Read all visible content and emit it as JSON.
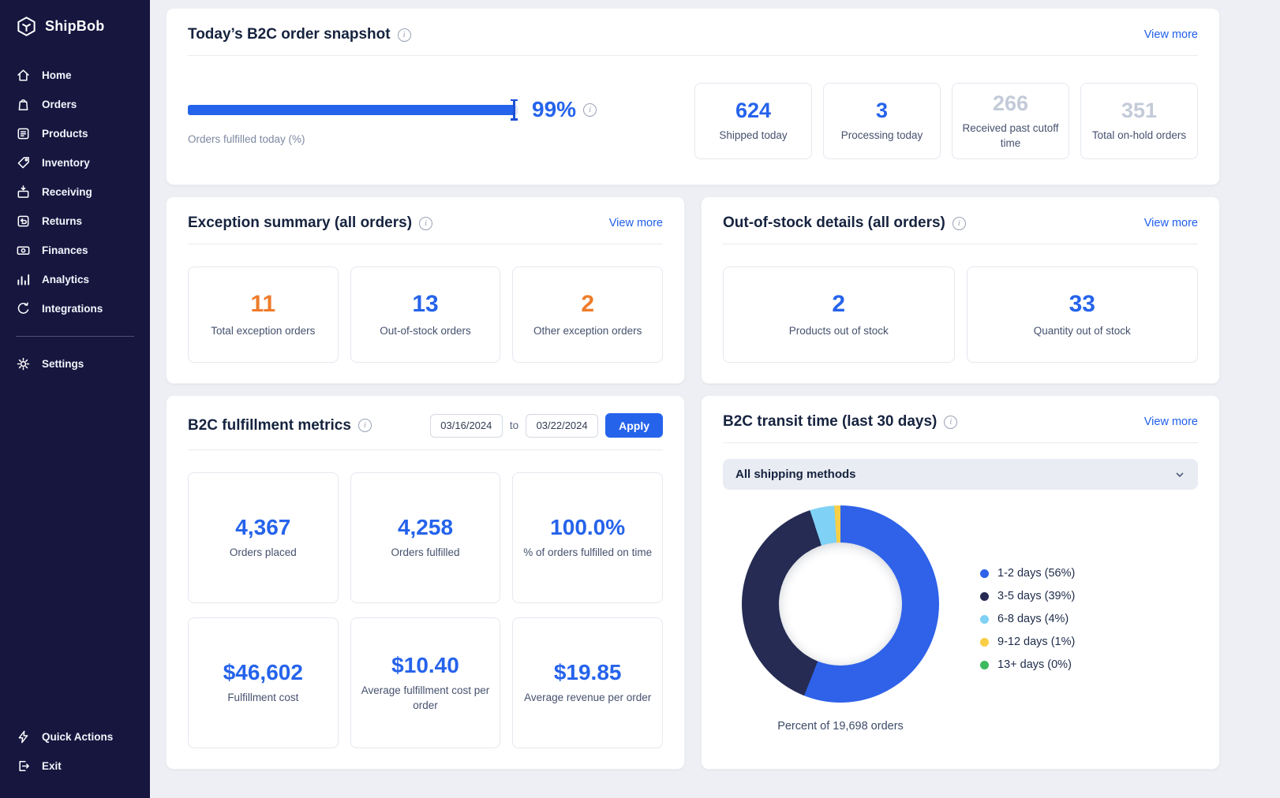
{
  "colors": {
    "accent_blue": "#2563eb",
    "orange": "#ee7c2b",
    "muted_gray": "#c3cad8",
    "sidebar_bg": "#16163f",
    "link_blue": "#1f5eea"
  },
  "sidebar": {
    "brand": "ShipBob",
    "items": [
      {
        "label": "Home",
        "icon": "home-icon"
      },
      {
        "label": "Orders",
        "icon": "orders-icon"
      },
      {
        "label": "Products",
        "icon": "products-icon"
      },
      {
        "label": "Inventory",
        "icon": "inventory-icon"
      },
      {
        "label": "Receiving",
        "icon": "receiving-icon"
      },
      {
        "label": "Returns",
        "icon": "returns-icon"
      },
      {
        "label": "Finances",
        "icon": "finances-icon"
      },
      {
        "label": "Analytics",
        "icon": "analytics-icon"
      },
      {
        "label": "Integrations",
        "icon": "integrations-icon"
      }
    ],
    "settings_label": "Settings",
    "footer_items": [
      {
        "label": "Quick Actions",
        "icon": "lightning-icon"
      },
      {
        "label": "Exit",
        "icon": "exit-icon"
      }
    ]
  },
  "snapshot": {
    "title": "Today’s B2C order snapshot",
    "view_more": "View more",
    "progress_value": 99,
    "progress_pct": "99%",
    "progress_label": "Orders fulfilled today (%)",
    "stats": [
      {
        "value": "624",
        "label": "Shipped today",
        "color": "blue"
      },
      {
        "value": "3",
        "label": "Processing today",
        "color": "blue"
      },
      {
        "value": "266",
        "label": "Received past cutoff time",
        "color": "gray"
      },
      {
        "value": "351",
        "label": "Total on-hold orders",
        "color": "gray"
      }
    ]
  },
  "exceptions": {
    "title": "Exception summary (all orders)",
    "view_more": "View more",
    "stats": [
      {
        "value": "11",
        "label": "Total exception orders",
        "color": "orange"
      },
      {
        "value": "13",
        "label": "Out-of-stock orders",
        "color": "blue"
      },
      {
        "value": "2",
        "label": "Other exception orders",
        "color": "orange"
      }
    ]
  },
  "out_of_stock": {
    "title": "Out-of-stock details (all orders)",
    "view_more": "View more",
    "stats": [
      {
        "value": "2",
        "label": "Products out of stock",
        "color": "blue"
      },
      {
        "value": "33",
        "label": "Quantity out of stock",
        "color": "blue"
      }
    ]
  },
  "fulfillment": {
    "title": "B2C fulfillment metrics",
    "date_from": "03/16/2024",
    "to_label": "to",
    "date_to": "03/22/2024",
    "apply_label": "Apply",
    "stats": [
      {
        "value": "4,367",
        "label": "Orders placed",
        "color": "blue"
      },
      {
        "value": "4,258",
        "label": "Orders fulfilled",
        "color": "blue"
      },
      {
        "value": "100.0%",
        "label": "% of orders fulfilled on time",
        "color": "blue"
      },
      {
        "value": "$46,602",
        "label": "Fulfillment cost",
        "color": "blue"
      },
      {
        "value": "$10.40",
        "label": "Average fulfillment cost per order",
        "color": "blue"
      },
      {
        "value": "$19.85",
        "label": "Average revenue per order",
        "color": "blue"
      }
    ]
  },
  "transit": {
    "title": "B2C transit time (last 30 days)",
    "view_more": "View more",
    "dropdown_label": "All shipping methods",
    "caption": "Percent of 19,698 orders"
  },
  "chart_data": {
    "type": "pie",
    "title": "B2C transit time (last 30 days)",
    "categories": [
      "1-2 days",
      "3-5 days",
      "6-8 days",
      "9-12 days",
      "13+ days"
    ],
    "values": [
      56,
      39,
      4,
      1,
      0
    ],
    "labels": [
      "1-2 days (56%)",
      "3-5 days (39%)",
      "6-8 days (4%)",
      "9-12 days (1%)",
      "13+ days (0%)"
    ],
    "colors": [
      "#2f62e9",
      "#252b52",
      "#7fd1f5",
      "#f7ce46",
      "#3dba5f"
    ],
    "donut": true,
    "legend_position": "right",
    "caption": "Percent of 19,698 orders"
  }
}
